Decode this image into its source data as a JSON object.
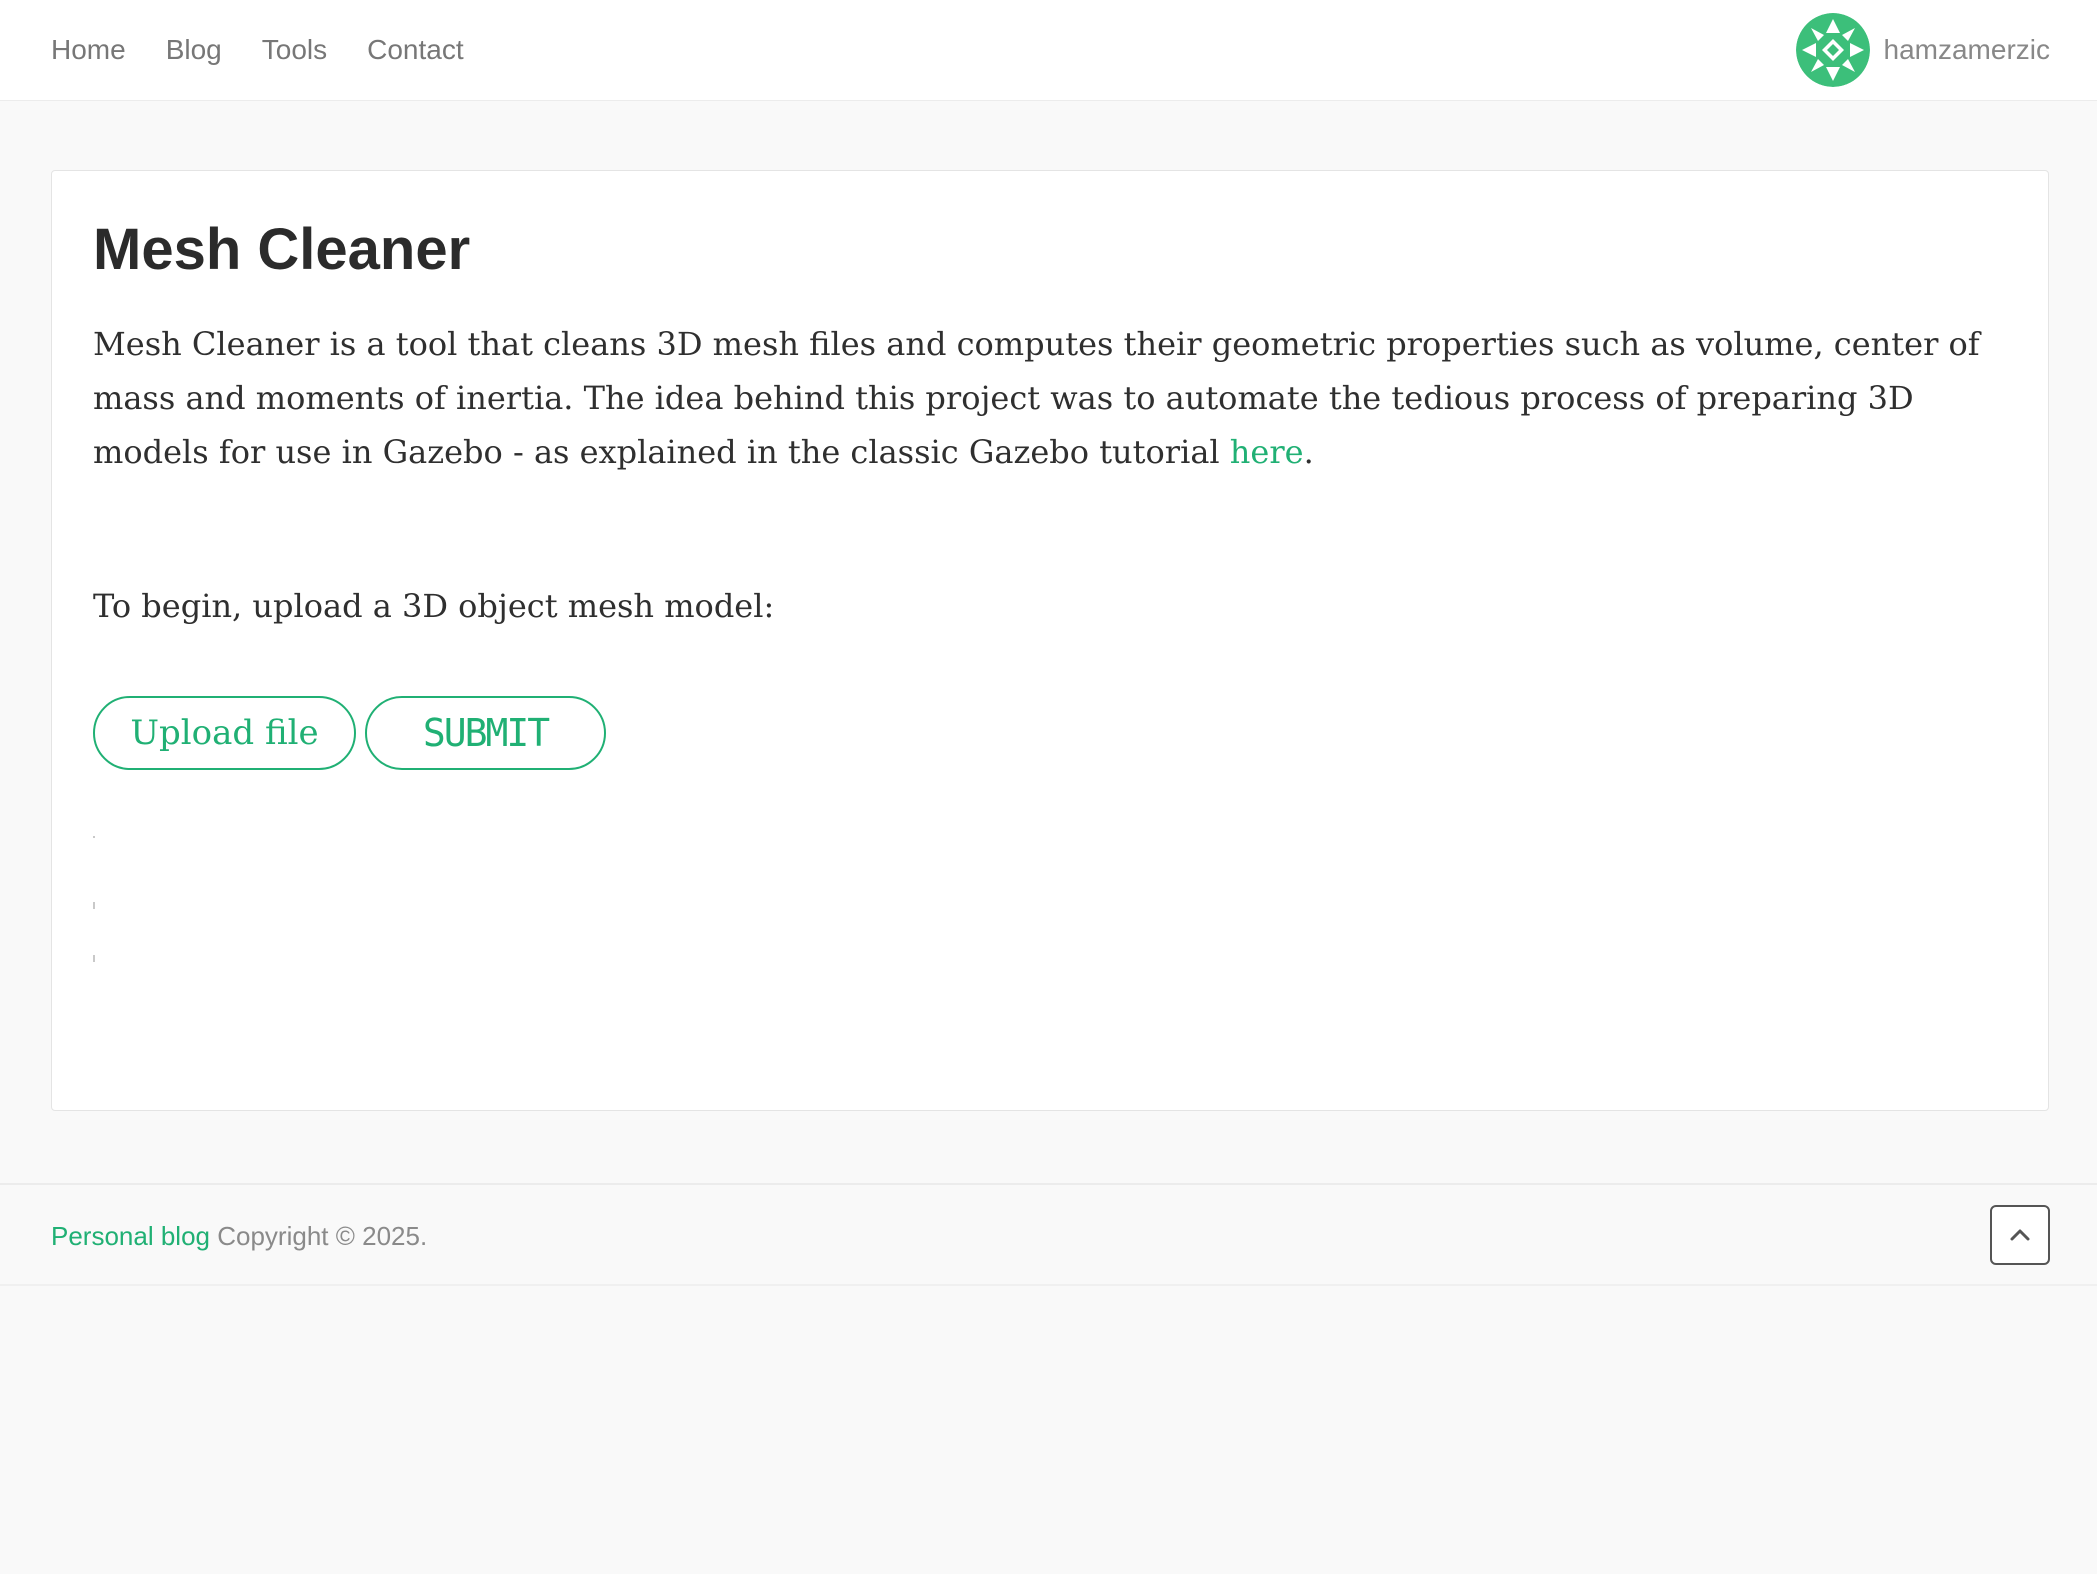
{
  "nav": {
    "items": [
      {
        "label": "Home"
      },
      {
        "label": "Blog"
      },
      {
        "label": "Tools"
      },
      {
        "label": "Contact"
      }
    ]
  },
  "user": {
    "name": "hamzamerzic",
    "avatar_icon": "geometric-logo-icon",
    "avatar_color": "#3cbf7a"
  },
  "main": {
    "title": "Mesh Cleaner",
    "description_before_link": "Mesh Cleaner is a tool that cleans 3D mesh files and computes their geometric properties such as volume, center of mass and moments of inertia. The idea behind this project was to automate the tedious process of preparing 3D models for use in Gazebo - as explained in the classic Gazebo tutorial ",
    "description_link": "here",
    "description_after_link": ".",
    "begin_text": "To begin, upload a 3D object mesh model:",
    "upload_label": "Upload file",
    "submit_label": "SUBMIT"
  },
  "footer": {
    "link": "Personal blog",
    "copyright": " Copyright © 2025.",
    "back_to_top_icon": "chevron-up-icon"
  },
  "colors": {
    "accent": "#20b074",
    "background": "#f9f9f9",
    "card": "#ffffff"
  }
}
